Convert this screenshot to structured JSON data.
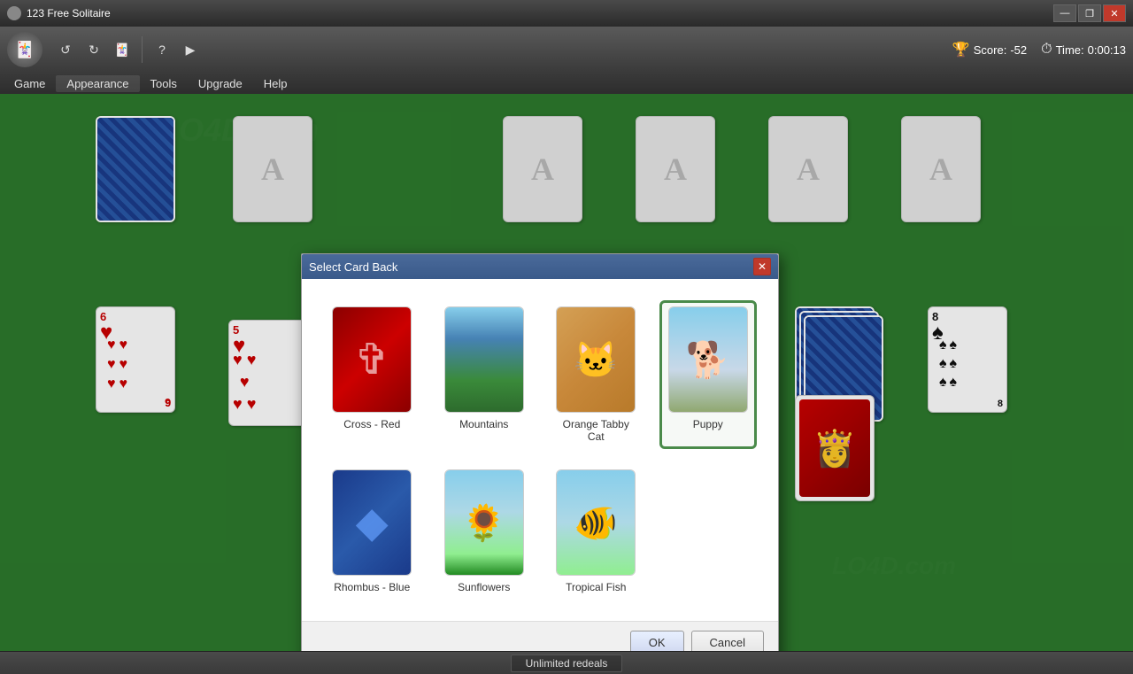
{
  "titlebar": {
    "title": "123 Free Solitaire",
    "controls": {
      "minimize": "—",
      "maximize": "❐",
      "close": "✕"
    }
  },
  "toolbar": {
    "buttons": [
      "↺",
      "↻",
      "🃏",
      "?",
      "▶"
    ]
  },
  "menubar": {
    "items": [
      "Game",
      "Appearance",
      "Tools",
      "Upgrade",
      "Help"
    ]
  },
  "scorebar": {
    "score_label": "Score:",
    "score_value": "-52",
    "time_label": "Time:",
    "time_value": "0:00:13"
  },
  "statusbar": {
    "text": "Unlimited redeals"
  },
  "dialog": {
    "title": "Select Card Back",
    "close_btn": "✕",
    "cards": [
      {
        "id": "cross-red",
        "label": "Cross - Red",
        "selected": false
      },
      {
        "id": "mountains",
        "label": "Mountains",
        "selected": false
      },
      {
        "id": "orange-tabby-cat",
        "label": "Orange Tabby Cat",
        "selected": false
      },
      {
        "id": "puppy",
        "label": "Puppy",
        "selected": true
      },
      {
        "id": "rhombus-blue",
        "label": "Rhombus - Blue",
        "selected": false
      },
      {
        "id": "sunflowers",
        "label": "Sunflowers",
        "selected": false
      },
      {
        "id": "tropical-fish",
        "label": "Tropical Fish",
        "selected": false
      }
    ],
    "ok_btn": "OK",
    "cancel_btn": "Cancel"
  }
}
